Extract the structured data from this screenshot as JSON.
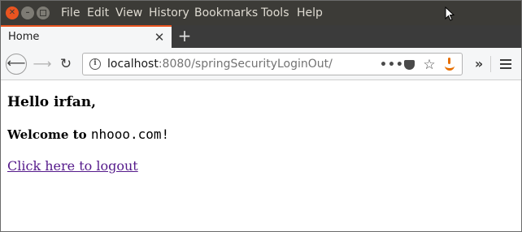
{
  "window": {
    "menu": [
      "File",
      "Edit",
      "View",
      "History",
      "Bookmarks",
      "Tools",
      "Help"
    ]
  },
  "tabs": [
    {
      "title": "Home"
    }
  ],
  "toolbar": {
    "url_host": "localhost",
    "url_path": ":8080/springSecurityLoginOut/",
    "page_actions_icon": "more-dots-icon",
    "pocket_icon": "pocket-icon",
    "bookmark_icon": "star-icon",
    "extension_icon": "java-icon"
  },
  "page": {
    "greeting": "Hello irfan,",
    "welcome_prefix": "Welcome to",
    "welcome_site": "nhooo.com!",
    "logout_link": "Click here to logout",
    "link_color": "#551a8b"
  },
  "colors": {
    "titlebar": "#3c3b37",
    "accent": "#e95420"
  }
}
